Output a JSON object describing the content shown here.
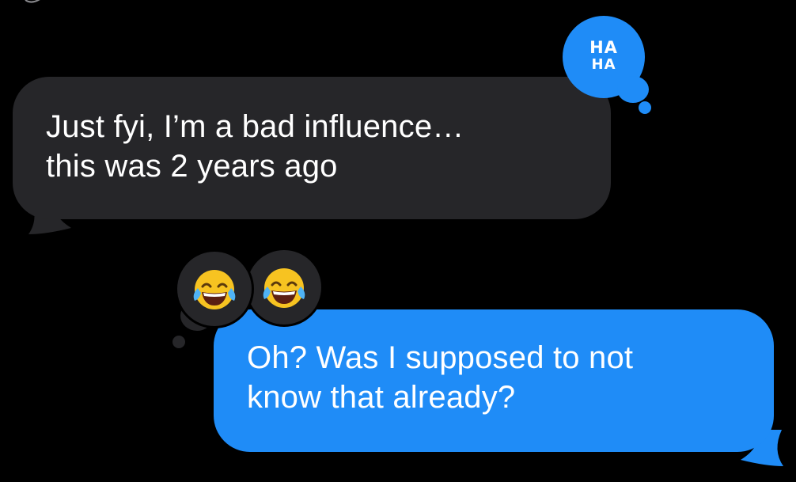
{
  "messages": {
    "incoming": {
      "lines": [
        "Just fyi, I’m a bad influence…",
        "this was 2 years ago"
      ],
      "reaction": "haha"
    },
    "outgoing": {
      "lines": [
        "Oh? Was I supposed to not",
        "know that already?"
      ],
      "reactions": [
        "face-with-tears-of-joy",
        "face-with-tears-of-joy"
      ]
    }
  },
  "tapbacks": {
    "haha_row1": "HA",
    "haha_row2": "HA"
  },
  "colors": {
    "background": "#000000",
    "incoming_bubble": "#262629",
    "outgoing_bubble": "#1f8cf7",
    "text": "#ffffff"
  }
}
